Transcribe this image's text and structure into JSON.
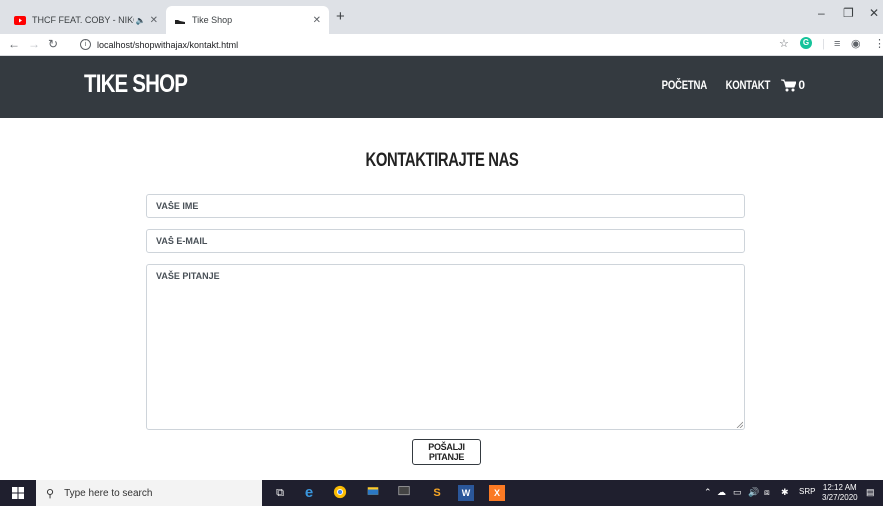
{
  "browser": {
    "tabs": [
      {
        "title": "THCF FEAT. COBY - NIKOM N",
        "active": false
      },
      {
        "title": "Tike Shop",
        "active": true
      }
    ],
    "new_tab_label": "+",
    "url": "localhost/shopwithajax/kontakt.html",
    "extension_letter": "G"
  },
  "site": {
    "brand": "TIKE SHOP",
    "nav": {
      "home": "POČETNA",
      "contact": "KONTAKT",
      "cart_count": "0"
    }
  },
  "contact": {
    "title": "KONTAKTIRAJTE NAS",
    "name_placeholder": "VAŠE IME",
    "email_placeholder": "VAŠ E-MAIL",
    "question_placeholder": "VAŠE PITANJE",
    "submit_label": "POŠALJI PITANJE"
  },
  "taskbar": {
    "search_placeholder": "Type here to search",
    "language": "SRP",
    "time": "12:12 AM",
    "date": "3/27/2020"
  },
  "colors": {
    "header_bg": "#343a40",
    "youtube_red": "#ff0000"
  }
}
